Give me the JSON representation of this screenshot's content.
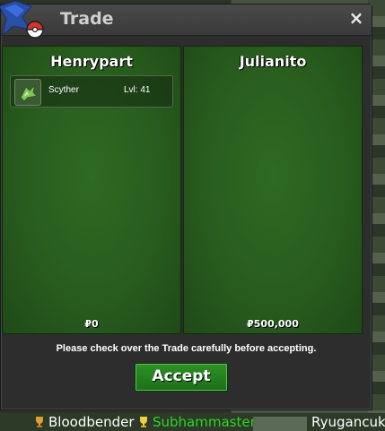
{
  "window": {
    "title": "Trade",
    "close_icon": "×"
  },
  "panels": [
    {
      "player": "Henrypart",
      "items": [
        {
          "name": "Scyther",
          "level": "Lvl: 41"
        }
      ],
      "money": "₽0"
    },
    {
      "player": "Julianito",
      "items": [],
      "money": "₽500,000"
    }
  ],
  "notice": "Please check over the Trade carefully before accepting.",
  "accept_label": "Accept",
  "bottom_players": [
    "Bloodbender",
    "Subhammaster",
    "Ryugancuk"
  ],
  "colors": {
    "panel_green": "#285c1e",
    "accept_green": "#2f9128",
    "highlight": "#29d629"
  }
}
